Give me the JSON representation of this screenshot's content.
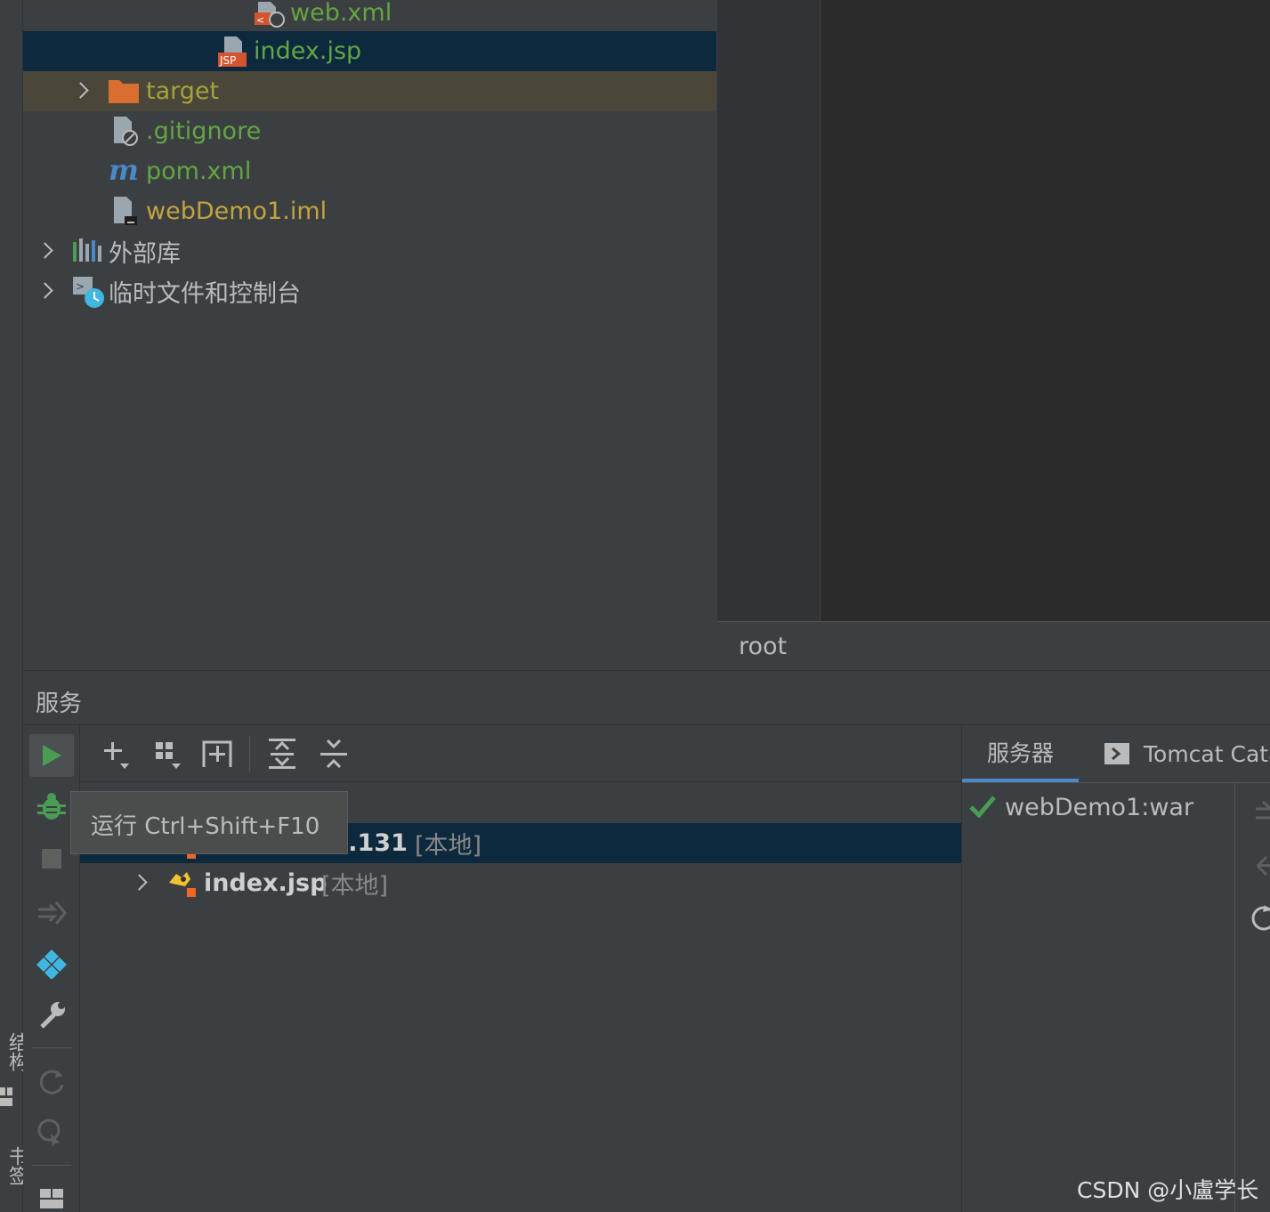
{
  "side_strip": {
    "structure_label": "结构",
    "bookmarks_label": "书签"
  },
  "project_tree": {
    "items": [
      {
        "label": "web.xml",
        "icon": "xml-file-icon"
      },
      {
        "label": "index.jsp",
        "icon": "jsp-file-icon",
        "selected": true
      },
      {
        "label": "target",
        "icon": "folder-icon",
        "excluded": true
      },
      {
        "label": ".gitignore",
        "icon": "ignored-file-icon"
      },
      {
        "label": "pom.xml",
        "icon": "maven-icon"
      },
      {
        "label": "webDemo1.iml",
        "icon": "module-file-icon"
      },
      {
        "label": "外部库",
        "icon": "library-icon"
      },
      {
        "label": "临时文件和控制台",
        "icon": "scratch-icon"
      }
    ]
  },
  "editor": {
    "breadcrumb": "root"
  },
  "services": {
    "title": "服务",
    "tooltip": "运行  Ctrl+Shift+F10",
    "rows": [
      {
        "label": "l.131",
        "tag": "[本地]",
        "selected": true
      },
      {
        "label": "index.jsp",
        "tag": "[本地]"
      }
    ],
    "right_tabs": [
      {
        "label": "服务器",
        "active": true
      },
      {
        "label": "Tomcat Cata"
      }
    ],
    "deployment": {
      "label": "webDemo1:war",
      "status": "deployed"
    }
  },
  "watermark": "CSDN @小盧学长",
  "colors": {
    "selection": "#0d293e",
    "excluded": "#4a4639",
    "run_green": "#499c54",
    "accent_blue": "#4a88c7"
  }
}
